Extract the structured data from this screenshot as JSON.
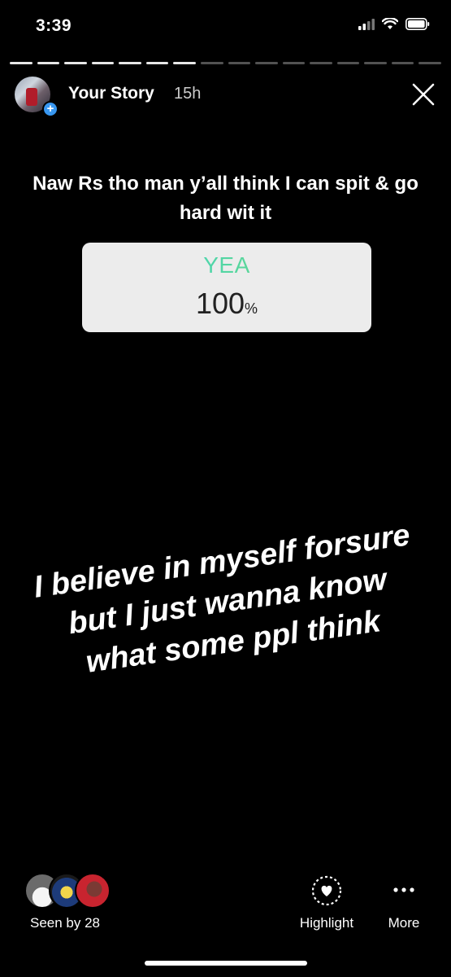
{
  "status_bar": {
    "time": "3:39",
    "icons": [
      "cellular-signal-icon",
      "wifi-icon",
      "battery-icon"
    ]
  },
  "progress": {
    "total_segments": 16,
    "completed_segments": 7
  },
  "story_header": {
    "owner": "Your Story",
    "age": "15h",
    "close_icon": "close-icon"
  },
  "poll": {
    "question": "Naw Rs tho man y’all think I can spit & go hard wit it",
    "option": "YEA",
    "percent": "100",
    "unit": "%"
  },
  "caption": "I believe in myself forsure but I just wanna know what some ppl think",
  "footer": {
    "seen_by": "Seen by 28",
    "highlight_label": "Highlight",
    "more_label": "More"
  },
  "colors": {
    "background": "#000000",
    "poll_card": "#ececec",
    "poll_gradient_start": "#2ed3d6",
    "poll_gradient_end": "#7bd96f",
    "badge_blue": "#3897f0"
  }
}
